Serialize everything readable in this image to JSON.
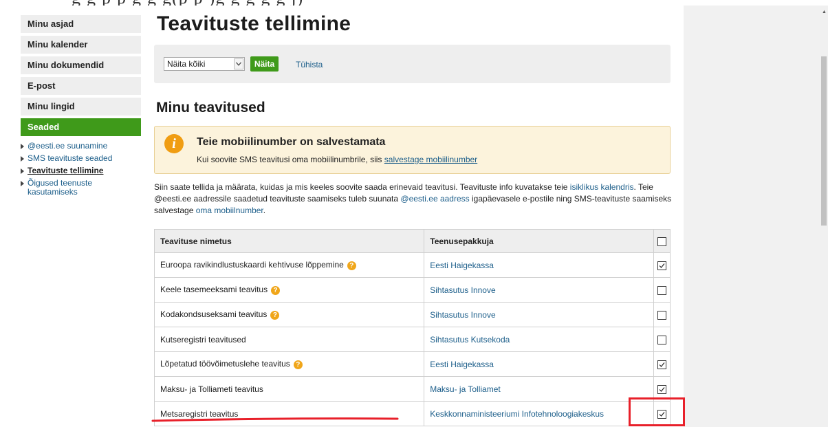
{
  "sidebar": {
    "items": [
      {
        "label": "Minu asjad",
        "active": false
      },
      {
        "label": "Minu kalender",
        "active": false
      },
      {
        "label": "Minu dokumendid",
        "active": false
      },
      {
        "label": "E-post",
        "active": false
      },
      {
        "label": "Minu lingid",
        "active": false
      },
      {
        "label": "Seaded",
        "active": true
      }
    ],
    "subitems": [
      {
        "label": "@eesti.ee suunamine",
        "current": false
      },
      {
        "label": "SMS teavituste seaded",
        "current": false
      },
      {
        "label": "Teavituste tellimine",
        "current": true
      },
      {
        "label": "Õigused teenuste kasutamiseks",
        "current": false
      }
    ]
  },
  "page": {
    "title": "Teavituste tellimine",
    "section_title": "Minu teavitused"
  },
  "filter": {
    "select_value": "Näita kõiki",
    "show_label": "Näita",
    "clear_label": "Tühista"
  },
  "notice": {
    "icon": "info-icon",
    "icon_glyph": "i",
    "title": "Teie mobiilinumber on salvestamata",
    "body_prefix": "Kui soovite SMS teavitusi oma mobiilinumbrile, siis",
    "body_link": "salvestage mobiilinumber"
  },
  "description": {
    "p1": "Siin saate tellida ja määrata, kuidas ja mis keeles soovite saada erinevaid teavitusi. Teavituste info kuvatakse teie",
    "l1": "isiklikus kalendris",
    "p2": ". Teie @eesti.ee aadressile saadetud teavituste saamiseks tuleb suunata",
    "l2": "@eesti.ee aadress",
    "p3": "igapäevasele e-postile ning SMS-teavituste saamiseks salvestage",
    "l3": "oma mobiilnumber",
    "p4": "."
  },
  "table": {
    "columns": [
      "Teavituse nimetus",
      "Teenusepakkuja"
    ],
    "header_checked": false,
    "rows": [
      {
        "name": "Euroopa ravikindlustuskaardi kehtivuse lõppemine",
        "help": true,
        "provider": "Eesti Haigekassa",
        "checked": true
      },
      {
        "name": "Keele tasemeeksami teavitus",
        "help": true,
        "provider": "Sihtasutus Innove",
        "checked": false
      },
      {
        "name": "Kodakondsuseksami teavitus",
        "help": true,
        "provider": "Sihtasutus Innove",
        "checked": false
      },
      {
        "name": "Kutseregistri teavitused",
        "help": false,
        "provider": "Sihtasutus Kutsekoda",
        "checked": false
      },
      {
        "name": "Lõpetatud töövõimetuslehe teavitus",
        "help": true,
        "provider": "Eesti Haigekassa",
        "checked": true
      },
      {
        "name": "Maksu- ja Tolliameti teavitus",
        "help": false,
        "provider": "Maksu- ja Tolliamet",
        "checked": true
      },
      {
        "name": "Metsaregistri teavitus",
        "help": false,
        "provider": "Keskkonnaministeeriumi Infotehnoloogiakeskus",
        "checked": true
      }
    ]
  },
  "colors": {
    "accent_green": "#3f9a1a",
    "link_blue": "#1c5e8a",
    "annotation_red": "#e8202a",
    "notice_bg": "#fcf3dc"
  }
}
